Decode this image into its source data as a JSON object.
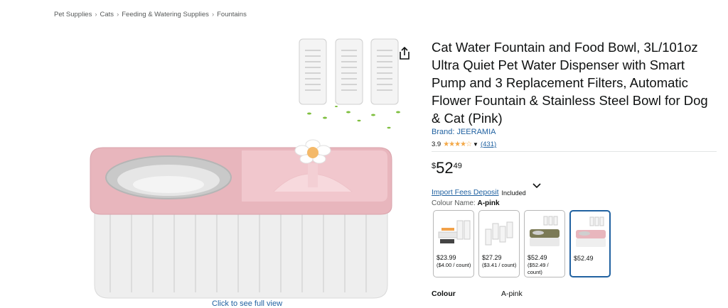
{
  "breadcrumb": [
    "Pet Supplies",
    "Cats",
    "Feeding & Watering Supplies",
    "Fountains"
  ],
  "product": {
    "title": "Cat Water Fountain and Food Bowl, 3L/101oz Ultra Quiet Pet Water Dispenser with Smart Pump and 3 Replacement Filters, Automatic Flower Fountain & Stainless Steel Bowl for Dog & Cat (Pink)",
    "brand": "Brand: JEERAMIA",
    "rating": "3.9",
    "rating_stars": "★★★★☆",
    "rating_count": "(431)",
    "price_symbol": "$",
    "price_whole": "52",
    "price_fraction": "49",
    "import_fees_label": "Import Fees Deposit",
    "import_fees_status": "Included",
    "colour_name_label": "Colour Name:",
    "colour_name_value": "A-pink",
    "image_link": "Click to see full view"
  },
  "swatches": [
    {
      "price": "$23.99",
      "unit": "($4.00 / count)",
      "selected": false
    },
    {
      "price": "$27.29",
      "unit": "($3.41 / count)",
      "selected": false
    },
    {
      "price": "$52.49",
      "unit": "($52.49 / count)",
      "selected": false
    },
    {
      "price": "$52.49",
      "unit": "",
      "selected": true
    }
  ],
  "specs": [
    {
      "label": "Colour",
      "value": "A-pink"
    }
  ],
  "icons": {
    "share": "share-icon",
    "chevron": "chevron-down-icon"
  },
  "colors": {
    "link": "#2162a1",
    "star": "#f3a847",
    "selected_border": "#2162a1",
    "pink": "#e8b6bd"
  }
}
